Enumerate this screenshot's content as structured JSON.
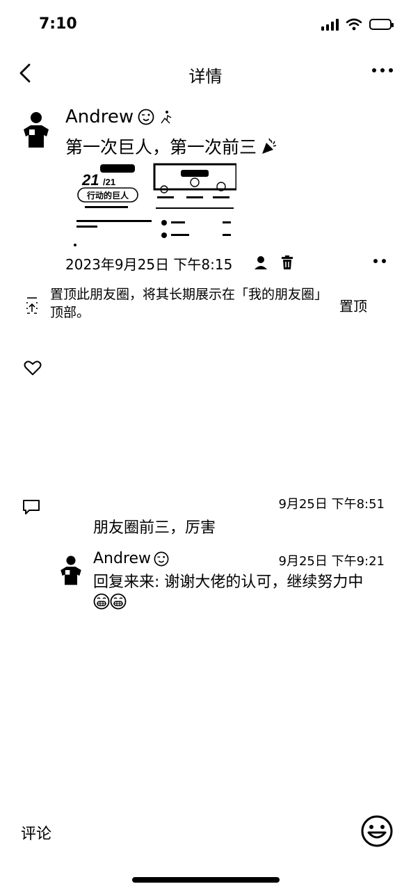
{
  "status": {
    "time": "7:10"
  },
  "nav": {
    "title": "详情"
  },
  "post": {
    "author": "Andrew",
    "text": "第一次巨人，第一次前三",
    "image1": {
      "big": "21",
      "small": "/21",
      "title": "行动的巨人"
    },
    "time": "2023年9月25日 下午8:15"
  },
  "pin": {
    "text": "置顶此朋友圈，将其长期展示在「我的朋友圈」顶部。",
    "button": "置顶"
  },
  "comments": [
    {
      "time": "9月25日 下午8:51",
      "text": "朋友圈前三，厉害"
    },
    {
      "author": "Andrew",
      "time": "9月25日 下午9:21",
      "text": "回复来来: 谢谢大佬的认可，继续努力中"
    }
  ],
  "bottom": {
    "placeholder": "评论"
  }
}
